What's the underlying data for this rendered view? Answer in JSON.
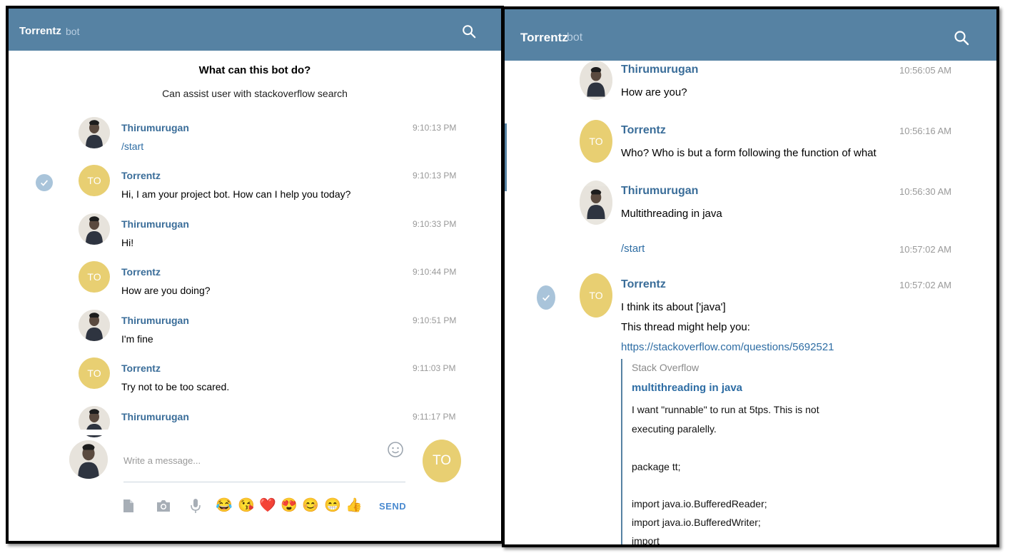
{
  "header": {
    "title": "Torrentz",
    "subtitle": "bot"
  },
  "left": {
    "intro": {
      "title": "What can this bot do?",
      "description": "Can assist user with stackoverflow search"
    },
    "messages": [
      {
        "sender": "Thirumurugan",
        "text": "/start",
        "time": "9:10:13 PM"
      },
      {
        "sender": "Torrentz",
        "text": "Hi, I am your project bot. How can I help you today?",
        "time": "9:10:13 PM"
      },
      {
        "sender": "Thirumurugan",
        "text": "Hi!",
        "time": "9:10:33 PM"
      },
      {
        "sender": "Torrentz",
        "text": "How are you doing?",
        "time": "9:10:44 PM"
      },
      {
        "sender": "Thirumurugan",
        "text": "I'm fine",
        "time": "9:10:51 PM"
      },
      {
        "sender": "Torrentz",
        "text": "Try not to be too scared.",
        "time": "9:11:03 PM"
      },
      {
        "sender": "Thirumurugan",
        "text": "",
        "time": "9:11:17 PM"
      }
    ],
    "avatar_initials": "TO",
    "composer": {
      "placeholder": "Write a message...",
      "send_label": "SEND",
      "send_avatar": "TO",
      "emojis": [
        "😂",
        "😘",
        "❤️",
        "😍",
        "😊",
        "😁",
        "👍"
      ]
    }
  },
  "right": {
    "messages": [
      {
        "sender": "Thirumurugan",
        "text": "How are you?",
        "time": "10:56:05 AM"
      },
      {
        "sender": "Torrentz",
        "text": "Who? Who is but a form following the function of what",
        "time": "10:56:16 AM"
      },
      {
        "sender": "Thirumurugan",
        "text": "Multithreading in java",
        "time": "10:56:30 AM"
      },
      {
        "sender": "",
        "text": "/start",
        "time": "10:57:02 AM"
      },
      {
        "sender": "Torrentz",
        "lines": [
          "I think its about ['java']",
          "This thread might help you:"
        ],
        "link": "https://stackoverflow.com/questions/5692521",
        "time": "10:57:02 AM"
      }
    ],
    "preview": {
      "site": "Stack Overflow",
      "title": "multithreading in java",
      "lines": [
        "I want \"runnable\" to run at 5tps. This is not",
        "executing paralelly.",
        "",
        "package tt;",
        "",
        "import java.io.BufferedReader;",
        "import java.io.BufferedWriter;",
        "import"
      ]
    }
  }
}
